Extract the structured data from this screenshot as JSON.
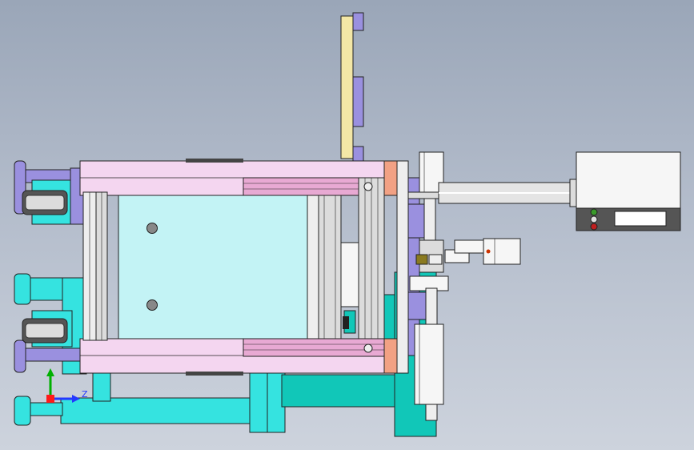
{
  "colors": {
    "frame_pink": "#f4d6f0",
    "pink_bar": "#e8a9d3",
    "panel_cyan": "#c3f3f5",
    "base_cyan": "#35e3e0",
    "teal": "#11c7b8",
    "plate_yellow": "#f3e7a6",
    "purple": "#9a90df",
    "salmon": "#f2a184",
    "grey": "#dcdcdc",
    "light_grey": "#eeeeee",
    "dark": "#444444",
    "axis_x": "#00b000",
    "axis_y": "#2438ff",
    "axis_origin": "#ff1a1a"
  },
  "axis_triad": {
    "z_label": "Z"
  },
  "control_box": {
    "display": ""
  }
}
